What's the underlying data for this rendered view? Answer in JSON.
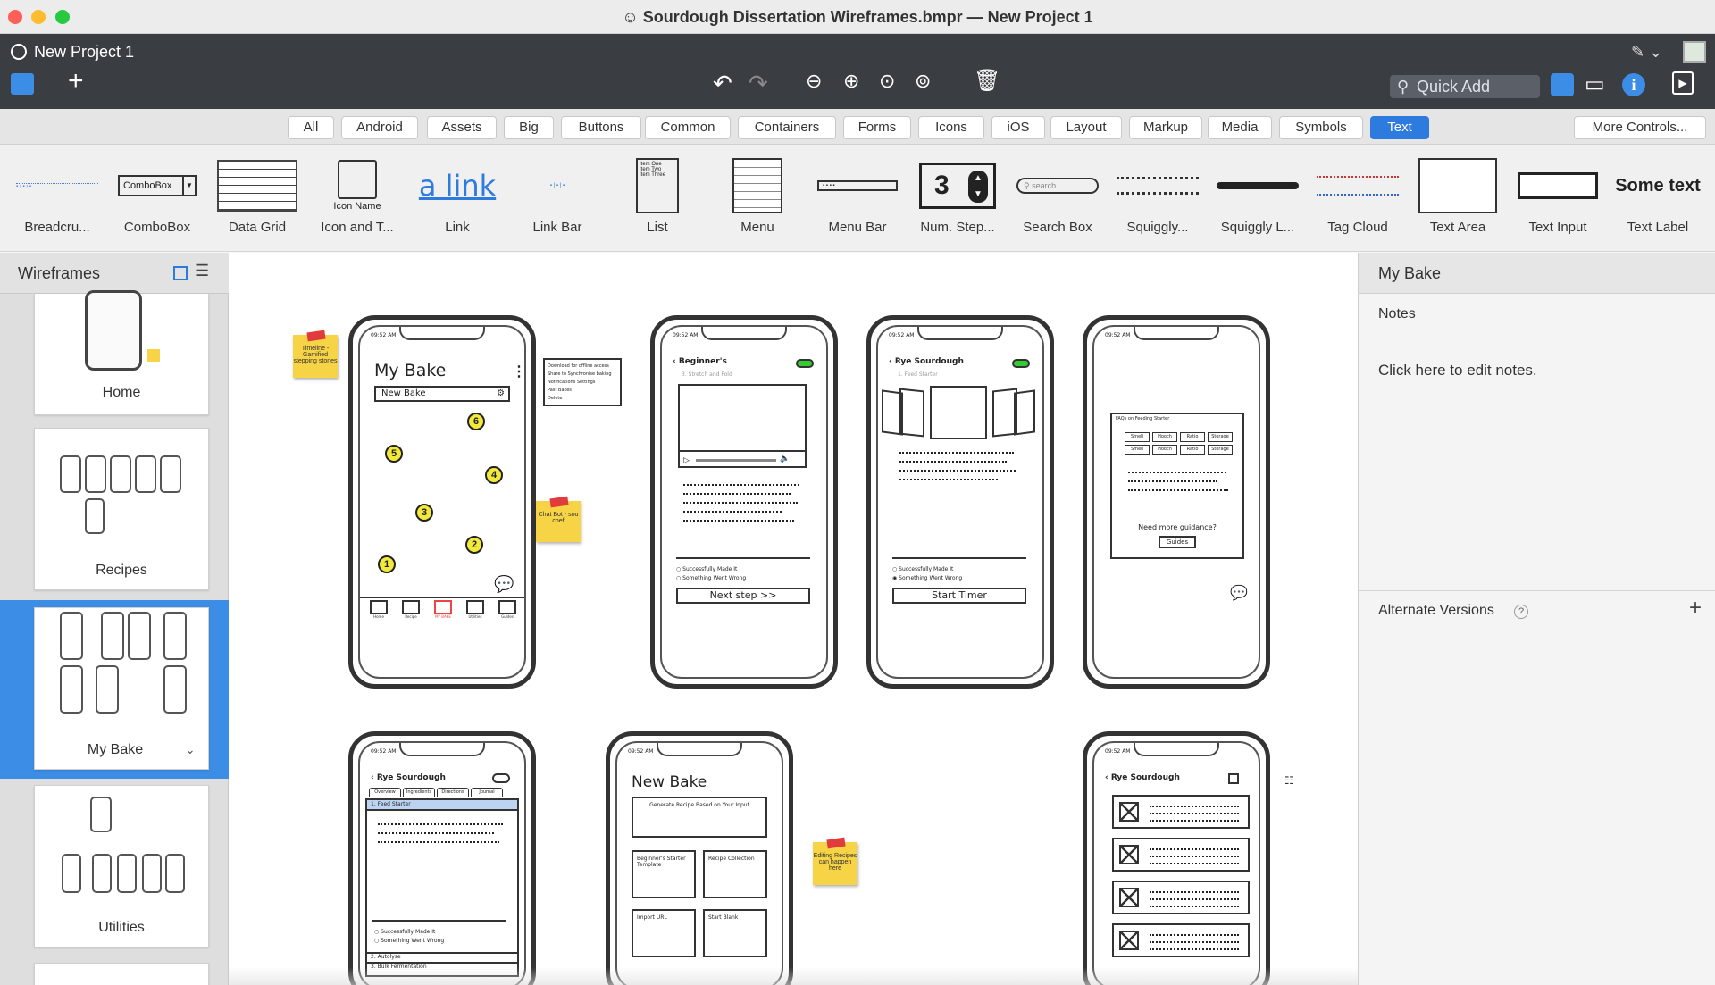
{
  "window": {
    "title": "Sourdough Dissertation Wireframes.bmpr — New Project 1",
    "project_name": "New Project 1"
  },
  "toolbar": {
    "quick_add_placeholder": "Quick Add"
  },
  "categories": [
    "All",
    "Android",
    "Assets",
    "Big",
    "Buttons",
    "Common",
    "Containers",
    "Forms",
    "Icons",
    "iOS",
    "Layout",
    "Markup",
    "Media",
    "Symbols",
    "Text"
  ],
  "active_category": "Text",
  "more_controls": "More Controls...",
  "library": [
    "Breadcru...",
    "ComboBox",
    "Data Grid",
    "Icon and T...",
    "Link",
    "Link Bar",
    "List",
    "Menu",
    "Menu Bar",
    "Num. Step...",
    "Search Box",
    "Squiggly...",
    "Squiggly L...",
    "Tag Cloud",
    "Text Area",
    "Text Input",
    "Text Label"
  ],
  "library_previews": {
    "combobox": "ComboBox",
    "icon_name": "Icon Name",
    "link": "a link",
    "num": "3",
    "search": "search",
    "some_text": "Some text",
    "list": [
      "Item One",
      "Item Two",
      "Item Three"
    ]
  },
  "sidebar": {
    "title": "Wireframes",
    "items": [
      "Home",
      "Recipes",
      "My Bake",
      "Utilities"
    ],
    "selected": "My Bake"
  },
  "canvas": {
    "time": "09:52 AM",
    "mybake": {
      "title": "My Bake",
      "input": "New Bake",
      "nums": [
        "6",
        "5",
        "4",
        "3",
        "2",
        "1"
      ],
      "tabs": [
        "Home",
        "Recipe",
        "MY BAKE",
        "Utilities",
        "Guides"
      ]
    },
    "menu_popup": [
      "Download for offline access",
      "Share to Synchronise baking",
      "Notifications Settings",
      "Past Bakes",
      "Delete"
    ],
    "beginner": {
      "title": "Beginner's",
      "step": "3. Stretch and Fold",
      "radio1": "Successfully Made It",
      "radio2": "Something Went Wrong",
      "button": "Next step >>"
    },
    "rye": {
      "title": "Rye Sourdough",
      "step": "1. Feed Starter",
      "radio1": "Successfully Made It",
      "radio2": "Something Went Wrong",
      "button": "Start Timer"
    },
    "faq": {
      "title": "FAQs on Feeding Starter",
      "tags": [
        "Smell",
        "Hooch",
        "Ratio",
        "Storage",
        "Smell",
        "Hooch",
        "Ratio",
        "Storage"
      ],
      "question": "Need more guidance?",
      "button": "Guides"
    },
    "rye2": {
      "title": "Rye Sourdough",
      "tabs": [
        "Overview",
        "Ingredients",
        "Directions",
        "Journal"
      ],
      "accordion": "1. Feed Starter",
      "radio1": "Successfully Made It",
      "radio2": "Something Went Wrong",
      "acc2": "2. Autolyse",
      "acc3": "3. Bulk Fermentation"
    },
    "newbake": {
      "title": "New Bake",
      "gen": "Generate Recipe Based on Your Input",
      "opt1": "Beginner's Starter Template",
      "opt2": "Recipe Collection",
      "opt3": "Import URL",
      "opt4": "Start Blank"
    },
    "rye3": {
      "title": "Rye Sourdough"
    },
    "stickies": [
      "Timeline - Gamified stepping stones",
      "Chat Bot - sou chef",
      "Editing Recipes can happen here"
    ]
  },
  "right_panel": {
    "title": "My Bake",
    "notes_label": "Notes",
    "notes_placeholder": "Click here to edit notes.",
    "alt_versions": "Alternate Versions",
    "help": "?"
  },
  "colors": {
    "accent": "#2e7be0",
    "dark_toolbar": "#3a3d42",
    "sticky": "#f7d445"
  }
}
